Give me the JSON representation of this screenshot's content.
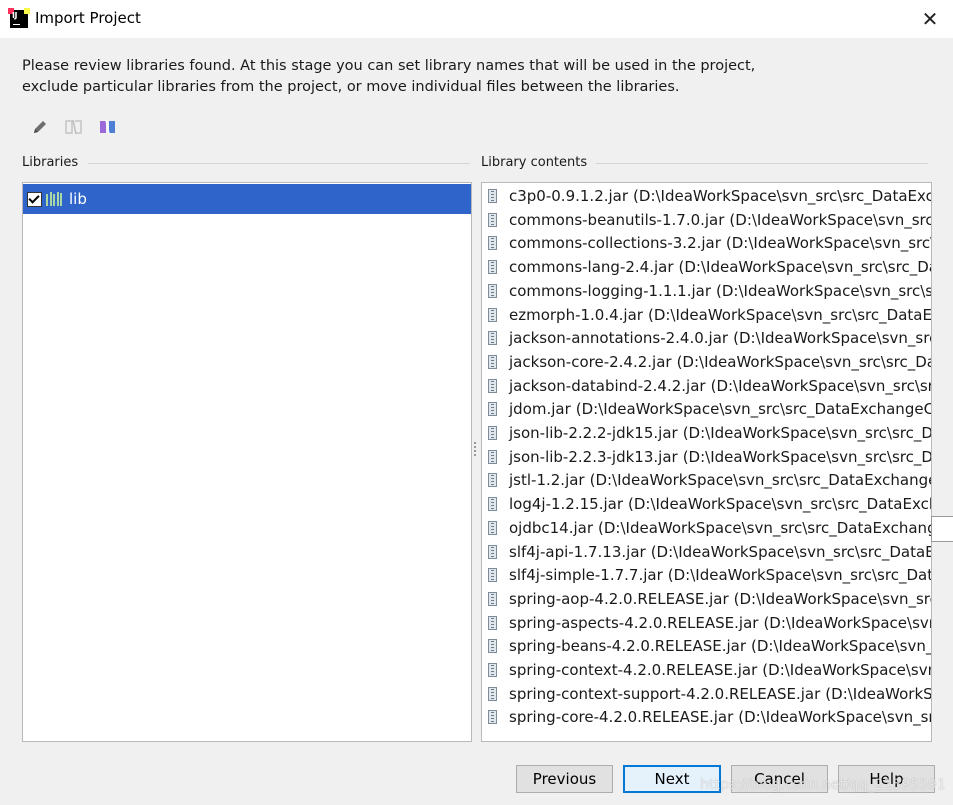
{
  "window": {
    "title": "Import Project",
    "close_glyph": "✕",
    "app_icon": "intellij-idea-icon"
  },
  "description": {
    "line1": "Please review libraries found. At this stage you can set library names that will be used in the project,",
    "line2": "exclude particular libraries from the project, or move individual files between the libraries."
  },
  "toolbar": {
    "icons": [
      "edit-pencil-icon",
      "split-library-icon",
      "merge-library-icon"
    ]
  },
  "libraries": {
    "label": "Libraries",
    "items": [
      {
        "label": "lib",
        "checked": true,
        "selected": true
      }
    ]
  },
  "contents": {
    "label": "Library contents",
    "items": [
      {
        "name": "c3p0-0.9.1.2.jar",
        "path": "(D:\\IdeaWorkSpace\\svn_src\\src_DataExcha"
      },
      {
        "name": "commons-beanutils-1.7.0.jar",
        "path": "(D:\\IdeaWorkSpace\\svn_src\\s"
      },
      {
        "name": "commons-collections-3.2.jar",
        "path": "(D:\\IdeaWorkSpace\\svn_src\\s"
      },
      {
        "name": "commons-lang-2.4.jar",
        "path": "(D:\\IdeaWorkSpace\\svn_src\\src_Dat"
      },
      {
        "name": "commons-logging-1.1.1.jar",
        "path": "(D:\\IdeaWorkSpace\\svn_src\\sr"
      },
      {
        "name": "ezmorph-1.0.4.jar",
        "path": "(D:\\IdeaWorkSpace\\svn_src\\src_DataExc"
      },
      {
        "name": "jackson-annotations-2.4.0.jar",
        "path": "(D:\\IdeaWorkSpace\\svn_src\\s"
      },
      {
        "name": "jackson-core-2.4.2.jar",
        "path": "(D:\\IdeaWorkSpace\\svn_src\\src_Data"
      },
      {
        "name": "jackson-databind-2.4.2.jar",
        "path": "(D:\\IdeaWorkSpace\\svn_src\\src_"
      },
      {
        "name": "jdom.jar",
        "path": "(D:\\IdeaWorkSpace\\svn_src\\src_DataExchangeCer"
      },
      {
        "name": "json-lib-2.2.2-jdk15.jar",
        "path": "(D:\\IdeaWorkSpace\\svn_src\\src_Dat"
      },
      {
        "name": "json-lib-2.2.3-jdk13.jar",
        "path": "(D:\\IdeaWorkSpace\\svn_src\\src_Dat"
      },
      {
        "name": "jstl-1.2.jar",
        "path": "(D:\\IdeaWorkSpace\\svn_src\\src_DataExchangeCe"
      },
      {
        "name": "log4j-1.2.15.jar",
        "path": "(D:\\IdeaWorkSpace\\svn_src\\src_DataExchar"
      },
      {
        "name": "ojdbc14.jar",
        "path": "(D:\\IdeaWorkSpace\\svn_src\\src_DataExchangeCen"
      },
      {
        "name": "slf4j-api-1.7.13.jar",
        "path": "(D:\\IdeaWorkSpace\\svn_src\\src_DataExc"
      },
      {
        "name": "slf4j-simple-1.7.7.jar",
        "path": "(D:\\IdeaWorkSpace\\svn_src\\src_DataE"
      },
      {
        "name": "spring-aop-4.2.0.RELEASE.jar",
        "path": "(D:\\IdeaWorkSpace\\svn_src\\s"
      },
      {
        "name": "spring-aspects-4.2.0.RELEASE.jar",
        "path": "(D:\\IdeaWorkSpace\\svn_s"
      },
      {
        "name": "spring-beans-4.2.0.RELEASE.jar",
        "path": "(D:\\IdeaWorkSpace\\svn_src"
      },
      {
        "name": "spring-context-4.2.0.RELEASE.jar",
        "path": "(D:\\IdeaWorkSpace\\svn_s"
      },
      {
        "name": "spring-context-support-4.2.0.RELEASE.jar",
        "path": "(D:\\IdeaWorkSp"
      },
      {
        "name": "spring-core-4.2.0.RELEASE.jar",
        "path": "(D:\\IdeaWorkSpace\\svn_src\\"
      }
    ]
  },
  "buttons": {
    "previous": "Previous",
    "next": "Next",
    "cancel": "Cancel",
    "help": "Help"
  },
  "watermark": "https://blog.csdn.net/qq_21595591",
  "colors": {
    "selection": "#2f65ca",
    "default_button_border": "#0078d7"
  }
}
